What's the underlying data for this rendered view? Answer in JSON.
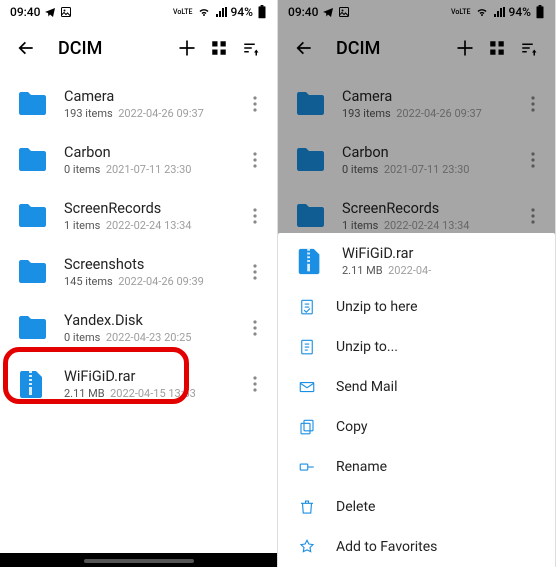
{
  "status": {
    "time": "09:40",
    "battery": "94%"
  },
  "appbar": {
    "title": "DCIM"
  },
  "files": [
    {
      "name": "Camera",
      "count": "193 items",
      "date": "2022-04-26 09:37",
      "kind": "folder"
    },
    {
      "name": "Carbon",
      "count": "0 items",
      "date": "2021-07-11 23:30",
      "kind": "folder"
    },
    {
      "name": "ScreenRecords",
      "count": "1 items",
      "date": "2022-02-24 13:34",
      "kind": "folder"
    },
    {
      "name": "Screenshots",
      "count": "145 items",
      "date": "2022-04-26 09:39",
      "kind": "folder"
    },
    {
      "name": "Yandex.Disk",
      "count": "0 items",
      "date": "2022-04-23 20:25",
      "kind": "folder"
    },
    {
      "name": "WiFiGiD.rar",
      "count": "2.11 MB",
      "date": "2022-04-15 13:53",
      "kind": "rar"
    }
  ],
  "sheet": {
    "file": {
      "name": "WiFiGiD.rar",
      "count": "2.11 MB",
      "date": "2022-04-"
    },
    "items": [
      {
        "label": "Unzip to here"
      },
      {
        "label": "Unzip to..."
      },
      {
        "label": "Send Mail"
      },
      {
        "label": "Copy"
      },
      {
        "label": "Rename"
      },
      {
        "label": "Delete"
      },
      {
        "label": "Add to Favorites"
      }
    ]
  }
}
